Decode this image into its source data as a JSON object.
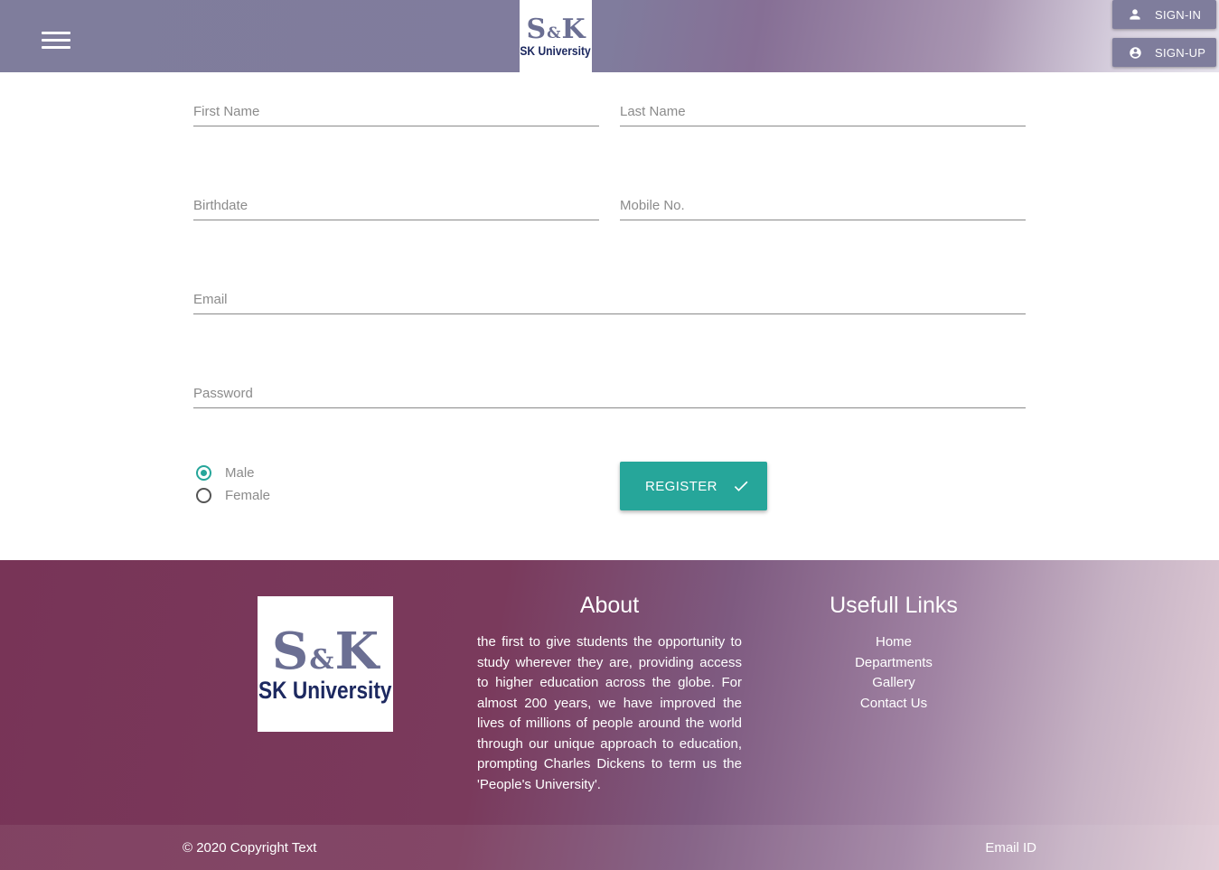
{
  "header": {
    "menu_icon": "hamburger-menu-icon",
    "logo": {
      "top": "S&K",
      "sk_left": "S",
      "amp": "&",
      "sk_right": "K",
      "bottom": "SK University"
    },
    "signin_label": "SIGN-IN",
    "signin_icon": "person-icon",
    "signup_label": "SIGN-UP",
    "signup_icon": "account-circle-icon",
    "gradient_colors": [
      "#7f7d9c",
      "#866f95",
      "#e6e3ec"
    ]
  },
  "form": {
    "first_name": {
      "placeholder": "First Name",
      "value": ""
    },
    "last_name": {
      "placeholder": "Last Name",
      "value": ""
    },
    "birthdate": {
      "placeholder": "Birthdate",
      "value": ""
    },
    "mobile": {
      "placeholder": "Mobile No.",
      "value": ""
    },
    "email": {
      "placeholder": "Email",
      "value": ""
    },
    "password": {
      "placeholder": "Password",
      "value": ""
    },
    "gender": {
      "options": [
        "Male",
        "Female"
      ],
      "selected": "Male"
    },
    "register_label": "REGISTER",
    "register_icon": "check-icon",
    "accent_color": "#26a69a"
  },
  "footer": {
    "logo": {
      "sk_left": "S",
      "amp": "&",
      "sk_right": "K",
      "bottom": "SK University"
    },
    "about_title": "About",
    "about_text": "the first to give students the opportunity to study wherever they are, providing access to higher education across the globe. For almost 200 years, we have improved the lives of millions of people around the world through our unique approach to education, prompting Charles Dickens to term us the 'People's University'.",
    "links_title": "Usefull Links",
    "links": [
      "Home",
      "Departments",
      "Gallery",
      "Contact Us"
    ],
    "copyright": "© 2020 Copyright Text",
    "email_id": "Email ID",
    "gradient_colors": [
      "#783457",
      "#7e5a80",
      "#e0ccd6"
    ]
  }
}
